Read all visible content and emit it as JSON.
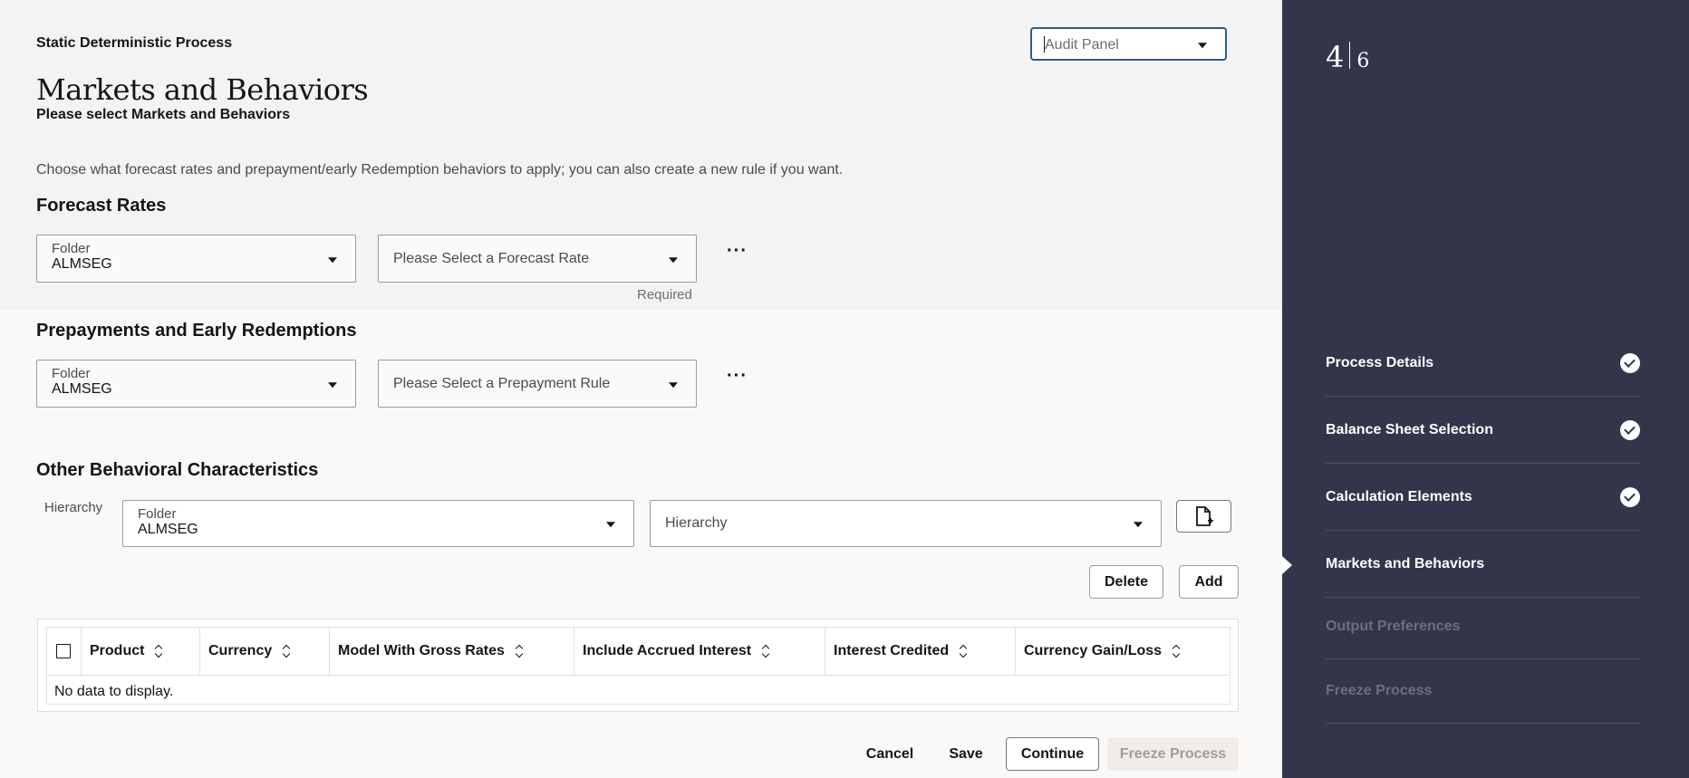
{
  "header": {
    "process_label": "Static Deterministic Process",
    "title": "Markets and Behaviors",
    "subtitle": "Please select Markets and Behaviors",
    "description": "Choose what forecast rates and prepayment/early Redemption behaviors to apply; you can also create a new rule if you want.",
    "audit_panel": "Audit Panel"
  },
  "forecast_rates": {
    "title": "Forecast Rates",
    "folder_label": "Folder",
    "folder_value": "ALMSEG",
    "rate_placeholder": "Please Select a Forecast Rate",
    "required_text": "Required",
    "more": "···"
  },
  "prepayments": {
    "title": "Prepayments and Early Redemptions",
    "folder_label": "Folder",
    "folder_value": "ALMSEG",
    "rule_placeholder": "Please Select a Prepayment Rule",
    "more": "···"
  },
  "other": {
    "title": "Other Behavioral Characteristics",
    "hierarchy_label": "Hierarchy",
    "folder_label": "Folder",
    "folder_value": "ALMSEG",
    "hierarchy_placeholder": "Hierarchy",
    "delete_label": "Delete",
    "add_label": "Add"
  },
  "table": {
    "columns": [
      "Product",
      "Currency",
      "Model With Gross Rates",
      "Include Accrued Interest",
      "Interest Credited",
      "Currency Gain/Loss"
    ],
    "empty_text": "No data to display."
  },
  "footer": {
    "cancel": "Cancel",
    "save": "Save",
    "continue": "Continue",
    "freeze": "Freeze Process"
  },
  "sidebar": {
    "current_step": "4",
    "total_steps": "6",
    "steps": [
      {
        "label": "Process Details",
        "state": "complete"
      },
      {
        "label": "Balance Sheet Selection",
        "state": "complete"
      },
      {
        "label": "Calculation Elements",
        "state": "complete"
      },
      {
        "label": "Markets and Behaviors",
        "state": "current"
      },
      {
        "label": "Output Preferences",
        "state": "disabled"
      },
      {
        "label": "Freeze Process",
        "state": "disabled"
      }
    ]
  }
}
